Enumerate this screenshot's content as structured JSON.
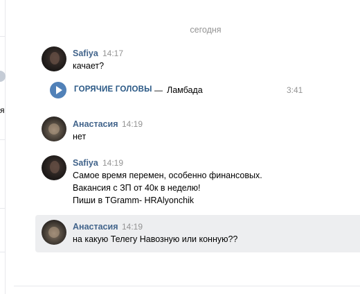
{
  "left_strip": {
    "glyph": "я"
  },
  "date_separator": "сегодня",
  "messages": [
    {
      "author": "Safiya",
      "time": "14:17",
      "text": "качает?",
      "attachment": {
        "type": "audio",
        "artist": "ГОРЯЧИЕ ГОЛОВЫ",
        "dash": "—",
        "title": "Ламбада",
        "duration": "3:41"
      }
    },
    {
      "author": "Анастасия",
      "time": "14:19",
      "text": "нет"
    },
    {
      "author": "Safiya",
      "time": "14:19",
      "lines": [
        "Самое время перемен, особенно финансовых.",
        "Вакансия с ЗП от 40к в неделю!",
        "Пиши в TGramm- HRAlyonchik"
      ]
    },
    {
      "author": "Анастасия",
      "time": "14:19",
      "text": "на какую Телегу Навозную или конную??",
      "highlighted": true
    }
  ],
  "colors": {
    "author": "#42648b",
    "time": "#939393",
    "audio_artist": "#2a5885",
    "play_button": "#5181b8",
    "highlight_bg": "#edeef0"
  },
  "icons": {
    "play": "play-icon"
  }
}
